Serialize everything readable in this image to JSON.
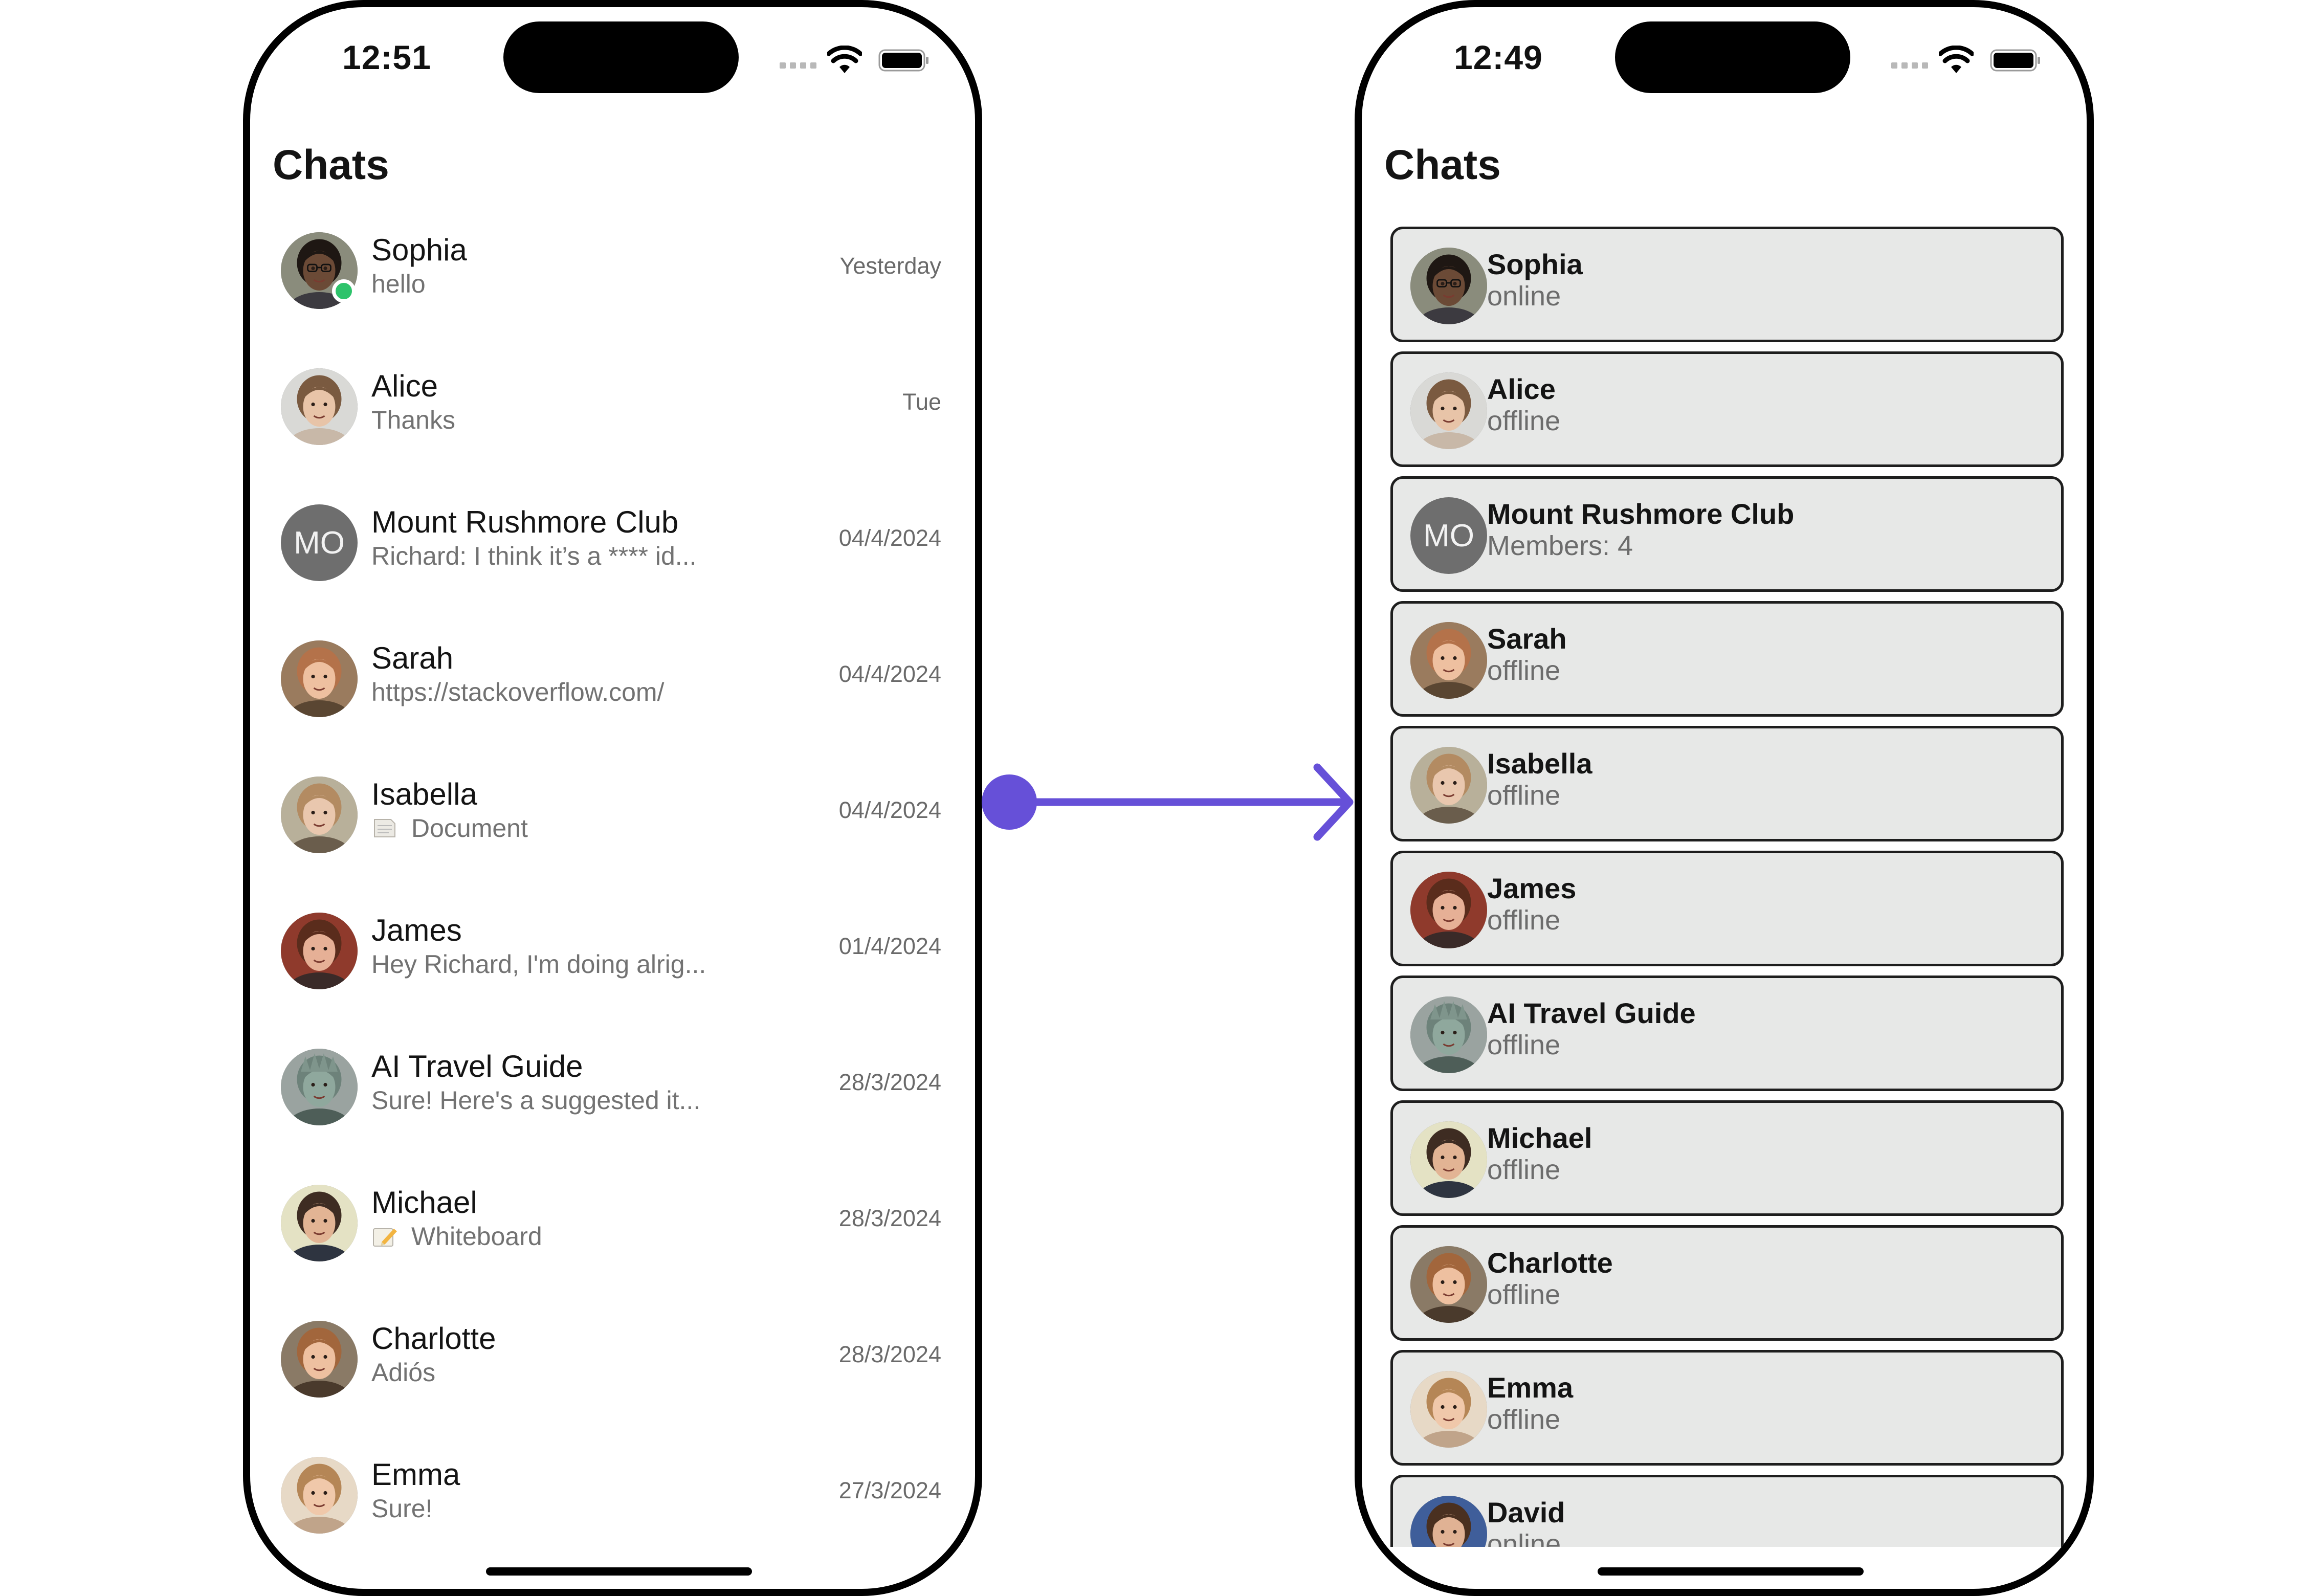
{
  "left": {
    "time": "12:51",
    "title": "Chats",
    "chats": [
      {
        "name": "Sophia",
        "message": "hello",
        "date": "Yesterday",
        "online": true,
        "avatar": "sophia"
      },
      {
        "name": "Alice",
        "message": "Thanks",
        "date": "Tue",
        "avatar": "alice"
      },
      {
        "name": "Mount Rushmore Club",
        "message": "Richard: I think it’s a **** id...",
        "date": "04/4/2024",
        "initials": "MO"
      },
      {
        "name": "Sarah",
        "message": "https://stackoverflow.com/",
        "date": "04/4/2024",
        "avatar": "sarah"
      },
      {
        "name": "Isabella",
        "message": "Document",
        "date": "04/4/2024",
        "avatar": "isabella",
        "icon": "document-icon"
      },
      {
        "name": "James",
        "message": "Hey Richard, I'm doing alrig...",
        "date": "01/4/2024",
        "avatar": "james"
      },
      {
        "name": "AI Travel Guide",
        "message": "Sure! Here's a suggested it...",
        "date": "28/3/2024",
        "avatar": "statue"
      },
      {
        "name": "Michael",
        "message": "Whiteboard",
        "date": "28/3/2024",
        "avatar": "michael",
        "icon": "whiteboard-icon"
      },
      {
        "name": "Charlotte",
        "message": "Adiós",
        "date": "28/3/2024",
        "avatar": "charlotte"
      },
      {
        "name": "Emma",
        "message": "Sure!",
        "date": "27/3/2024",
        "avatar": "emma"
      }
    ]
  },
  "right": {
    "time": "12:49",
    "title": "Chats",
    "chats": [
      {
        "name": "Sophia",
        "status": "online",
        "avatar": "sophia"
      },
      {
        "name": "Alice",
        "status": "offline",
        "avatar": "alice"
      },
      {
        "name": "Mount Rushmore Club",
        "status": "Members: 4",
        "initials": "MO"
      },
      {
        "name": "Sarah",
        "status": "offline",
        "avatar": "sarah"
      },
      {
        "name": "Isabella",
        "status": "offline",
        "avatar": "isabella"
      },
      {
        "name": "James",
        "status": "offline",
        "avatar": "james"
      },
      {
        "name": "AI Travel Guide",
        "status": "offline",
        "avatar": "statue"
      },
      {
        "name": "Michael",
        "status": "offline",
        "avatar": "michael"
      },
      {
        "name": "Charlotte",
        "status": "offline",
        "avatar": "charlotte"
      },
      {
        "name": "Emma",
        "status": "offline",
        "avatar": "emma"
      },
      {
        "name": "David",
        "status": "online",
        "avatar": "david"
      }
    ]
  },
  "icons": [
    "wifi-icon",
    "battery-icon",
    "signal-icon",
    "arrow-icon"
  ],
  "colors": {
    "arrow": "#6650d8",
    "online": "#2ec36b",
    "card_bg": "#e7e8e7",
    "initials_avatar": "#6e6e6e"
  }
}
